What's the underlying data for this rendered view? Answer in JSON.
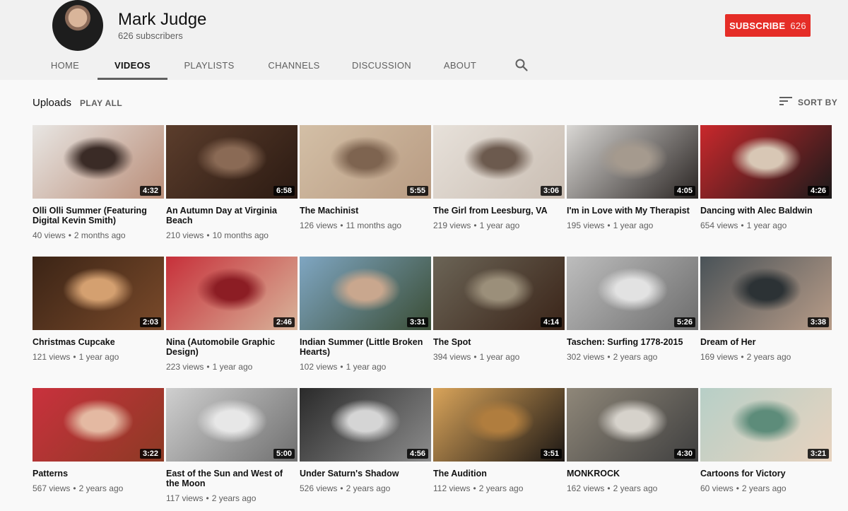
{
  "channel": {
    "name": "Mark Judge",
    "subscribers": "626 subscribers",
    "subscribe_label": "SUBSCRIBE",
    "subscribe_count": "626"
  },
  "tabs": [
    {
      "label": "HOME",
      "active": false
    },
    {
      "label": "VIDEOS",
      "active": true
    },
    {
      "label": "PLAYLISTS",
      "active": false
    },
    {
      "label": "CHANNELS",
      "active": false
    },
    {
      "label": "DISCUSSION",
      "active": false
    },
    {
      "label": "ABOUT",
      "active": false
    }
  ],
  "section": {
    "title": "Uploads",
    "play_all": "PLAY ALL",
    "sort_by": "SORT BY"
  },
  "colors": {
    "subscribe": "#e52d27",
    "background": "#f9f9f9",
    "header": "#f1f1f1"
  },
  "videos": [
    {
      "title": "Olli Olli Summer (Featuring Digital Kevin Smith)",
      "views": "40 views",
      "age": "2 months ago",
      "duration": "4:32",
      "thumb": [
        "#e8e6e3",
        "#b98d78",
        "#3a2b26"
      ]
    },
    {
      "title": "An Autumn Day at Virginia Beach",
      "views": "210 views",
      "age": "10 months ago",
      "duration": "6:58",
      "thumb": [
        "#5b3d2c",
        "#2b1a12",
        "#8a6a55"
      ]
    },
    {
      "title": "The Machinist",
      "views": "126 views",
      "age": "11 months ago",
      "duration": "5:55",
      "thumb": [
        "#d3bfa6",
        "#b89b82",
        "#7e6450"
      ]
    },
    {
      "title": "The Girl from Leesburg, VA",
      "views": "219 views",
      "age": "1 year ago",
      "duration": "3:06",
      "thumb": [
        "#e7e1da",
        "#c9bdb2",
        "#6c5a4e"
      ]
    },
    {
      "title": "I'm in Love with My Therapist",
      "views": "195 views",
      "age": "1 year ago",
      "duration": "4:05",
      "thumb": [
        "#d9d7d4",
        "#2a2523",
        "#a59a8e"
      ]
    },
    {
      "title": "Dancing with Alec Baldwin",
      "views": "654 views",
      "age": "1 year ago",
      "duration": "4:26",
      "thumb": [
        "#c9282c",
        "#1a1a1a",
        "#d8c7b5"
      ]
    },
    {
      "title": "Christmas Cupcake",
      "views": "121 views",
      "age": "1 year ago",
      "duration": "2:03",
      "thumb": [
        "#3b2416",
        "#7a4a2a",
        "#d4a070"
      ]
    },
    {
      "title": "Nina (Automobile Graphic Design)",
      "views": "223 views",
      "age": "1 year ago",
      "duration": "2:46",
      "thumb": [
        "#c7303a",
        "#d8b49a",
        "#8c1d24"
      ]
    },
    {
      "title": "Indian Summer (Little Broken Hearts)",
      "views": "102 views",
      "age": "1 year ago",
      "duration": "3:31",
      "thumb": [
        "#7fa6c2",
        "#3a4d35",
        "#c9a78e"
      ]
    },
    {
      "title": "The Spot",
      "views": "394 views",
      "age": "1 year ago",
      "duration": "4:14",
      "thumb": [
        "#6b6456",
        "#3a2418",
        "#9b8f7a"
      ]
    },
    {
      "title": "Taschen: Surfing 1778-2015",
      "views": "302 views",
      "age": "2 years ago",
      "duration": "5:26",
      "thumb": [
        "#bdbdbd",
        "#6d6d6d",
        "#e2e2e2"
      ]
    },
    {
      "title": "Dream of Her",
      "views": "169 views",
      "age": "2 years ago",
      "duration": "3:38",
      "thumb": [
        "#4a5358",
        "#b89c88",
        "#2c3235"
      ]
    },
    {
      "title": "Patterns",
      "views": "567 views",
      "age": "2 years ago",
      "duration": "3:22",
      "thumb": [
        "#c9313d",
        "#8c3a24",
        "#e4b9a2"
      ]
    },
    {
      "title": "East of the Sun and West of the Moon",
      "views": "117 views",
      "age": "2 years ago",
      "duration": "5:00",
      "thumb": [
        "#cfcfcf",
        "#6f6f6f",
        "#e7e7e7"
      ]
    },
    {
      "title": "Under Saturn's Shadow",
      "views": "526 views",
      "age": "2 years ago",
      "duration": "4:56",
      "thumb": [
        "#2a2a2a",
        "#8c8c8c",
        "#d5d5d5"
      ]
    },
    {
      "title": "The Audition",
      "views": "112 views",
      "age": "2 years ago",
      "duration": "3:51",
      "thumb": [
        "#d9a45a",
        "#1c1714",
        "#b07d3e"
      ]
    },
    {
      "title": "MONKROCK",
      "views": "162 views",
      "age": "2 years ago",
      "duration": "4:30",
      "thumb": [
        "#8f8779",
        "#3f3f3f",
        "#d6d2cb"
      ]
    },
    {
      "title": "Cartoons for Victory",
      "views": "60 views",
      "age": "2 years ago",
      "duration": "3:21",
      "thumb": [
        "#b7cfc7",
        "#e8d3bf",
        "#5d8c7a"
      ]
    }
  ]
}
